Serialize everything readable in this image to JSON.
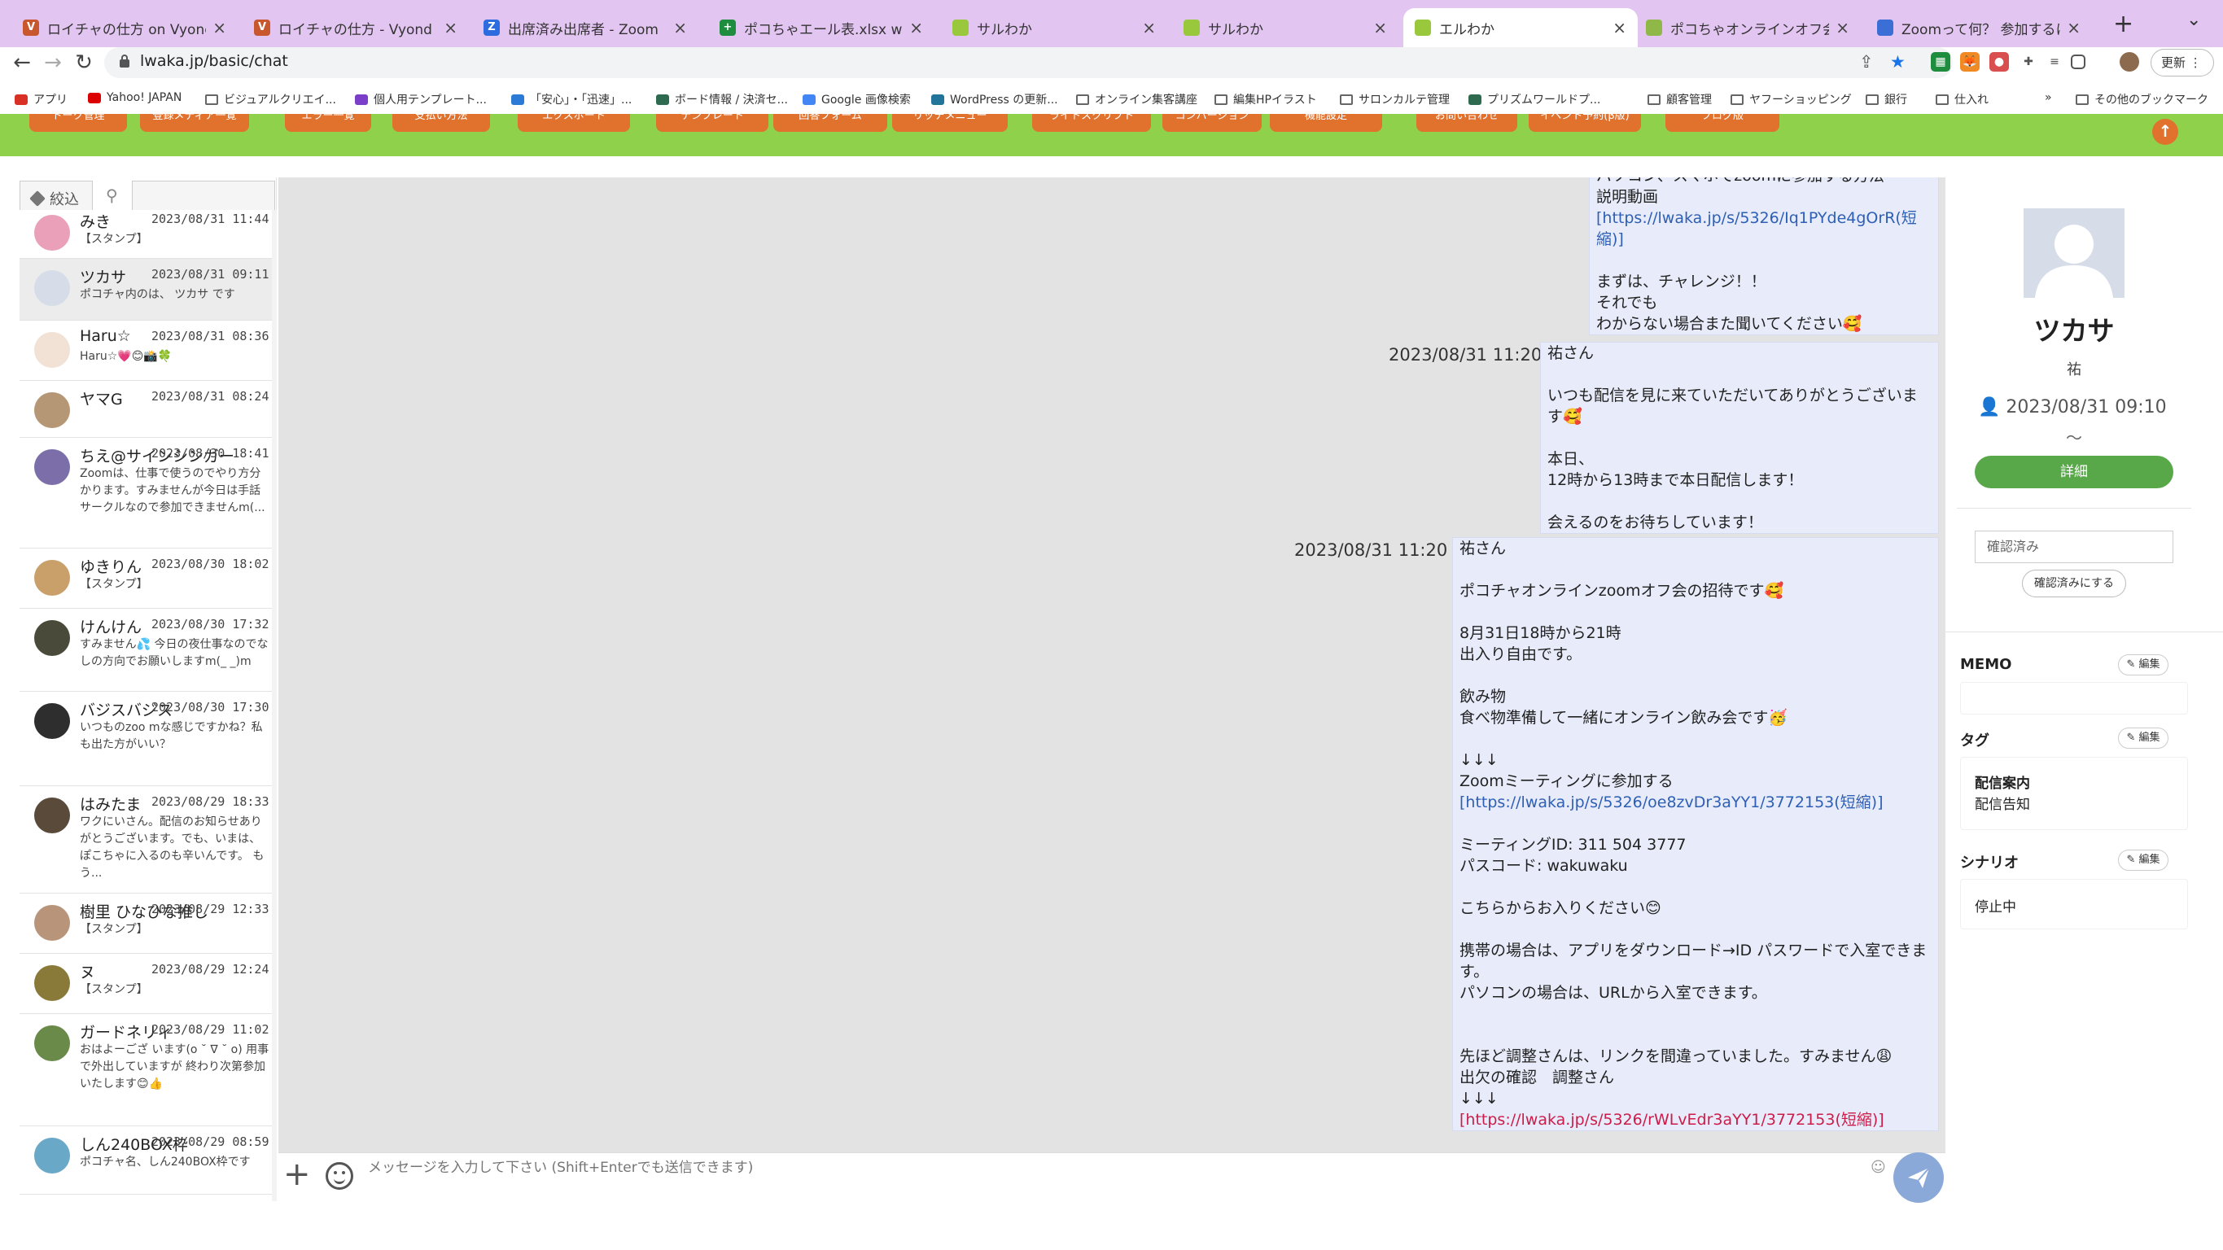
{
  "browser": {
    "tabs": [
      {
        "label": "ロイチャの仕方 on Vyond",
        "favicon": "V",
        "color": "#c9572e"
      },
      {
        "label": "ロイチャの仕方 - Vyond Studio",
        "favicon": "V",
        "color": "#c9572e"
      },
      {
        "label": "出席済み出席者 - Zoom",
        "favicon": "Z",
        "color": "#2d6cdf"
      },
      {
        "label": "ポコちゃエール表.xlsx wakuni",
        "favicon": "+",
        "color": "#1e8e3e"
      },
      {
        "label": "サルわか",
        "favicon": "",
        "color": "#9ac83c"
      },
      {
        "label": "サルわか",
        "favicon": "",
        "color": "#9ac83c"
      },
      {
        "label": "エルわか",
        "favicon": "",
        "color": "#9ac83c"
      },
      {
        "label": "ポコちゃオンラインオフ会 | 調整",
        "favicon": "",
        "color": "#8fb848"
      },
      {
        "label": "Zoomって何？ 参加するには、ど",
        "favicon": "",
        "color": "#3b6fd6"
      }
    ],
    "url": "lwaka.jp/basic/chat",
    "update_label": "更新",
    "bookmarks": [
      "アプリ",
      "Yahoo! JAPAN",
      "ビジュアルクリエイ...",
      "個人用テンプレート...",
      "「安心」・「迅速」...",
      "ボード情報 / 決済セ...",
      "Google 画像検索",
      "WordPress の更新...",
      "オンライン集客講座",
      "編集HPイラスト",
      "サロンカルテ管理",
      "プリズムワールドプ...",
      "顧客管理",
      "ヤフーショッピング",
      "銀行",
      "仕入れ"
    ],
    "bookmarks_more": "»",
    "other_bookmarks": "その他のブックマーク"
  },
  "nav_buttons": [
    "トーク管理",
    "登録メディア一覧",
    "エラー一覧",
    "支払い方法",
    "エクスポート",
    "テンプレート",
    "回答フォーム",
    "リッチメニュー",
    "ライトスクリプト",
    "コンバージョン",
    "機能設定",
    "お問い合わせ",
    "イベント予約(β版)",
    "ブログ版"
  ],
  "sidebar": {
    "filter_label": "絞込",
    "search_placeholder": "",
    "items": [
      {
        "name": "みき",
        "date": "2023/08/31 11:44",
        "msg": "【スタンプ】",
        "avatar_color": "#e9a0b8"
      },
      {
        "name": "ツカサ",
        "date": "2023/08/31 09:11",
        "msg": "ポコチャ内のは、 ツカサ です",
        "avatar_color": "#d6dde8"
      },
      {
        "name": "Haru☆",
        "date": "2023/08/31 08:36",
        "msg": "Haru☆💗😊📸🍀",
        "avatar_color": "#f2e2d6"
      },
      {
        "name": "ヤマG",
        "date": "2023/08/31 08:24",
        "msg": "",
        "avatar_color": "#b59776"
      },
      {
        "name": "ちえ@サインシンガー",
        "date": "2023/08/30 18:41",
        "msg": "Zoomは、仕事で使うのでやり方分かります。すみませんが今日は手話サークルなので参加できませんm(...",
        "avatar_color": "#7c6ea8"
      },
      {
        "name": "ゆきりん",
        "date": "2023/08/30 18:02",
        "msg": "【スタンプ】",
        "avatar_color": "#c9a06a"
      },
      {
        "name": "けんけん",
        "date": "2023/08/30 17:32",
        "msg": "すみません💦 今日の夜仕事なのでなしの方向でお願いしますm(_ _)m",
        "avatar_color": "#4a4a3a"
      },
      {
        "name": "バジスバジス",
        "date": "2023/08/30 17:30",
        "msg": "いつものzoo mな感じですかね？私も出た方がいい？",
        "avatar_color": "#2e2e2e"
      },
      {
        "name": "はみたま",
        "date": "2023/08/29 18:33",
        "msg": "ワクにいさん。配信のお知らせありがとうございます。でも、いまは、ぽこちゃに入るのも辛いんです。 もう...",
        "avatar_color": "#5a4a3a"
      },
      {
        "name": "樹里 ひなひな推し",
        "date": "2023/08/29 12:33",
        "msg": "【スタンプ】",
        "avatar_color": "#b8957a"
      },
      {
        "name": "ヌ",
        "date": "2023/08/29 12:24",
        "msg": "【スタンプ】",
        "avatar_color": "#8a7a3a"
      },
      {
        "name": "ガードネリィ",
        "date": "2023/08/29 11:02",
        "msg": "おはよーござ います(o ˘ ∇ ˘ o) 用事で外出していますが 終わり次第参加いたします😊👍",
        "avatar_color": "#6a8a4a"
      },
      {
        "name": "しん240BOX枠",
        "date": "2023/08/29 08:59",
        "msg": "ポコチャ名、しん240BOX枠です",
        "avatar_color": "#6aa8c8"
      }
    ]
  },
  "messages": [
    {
      "date": "",
      "lines": [
        "パソコン、スマホでzoomに参加する方法",
        "説明動画",
        "[https://lwaka.jp/s/5326/Iq1PYde4gOrR(短縮)]",
        "",
        "まずは、チャレンジ！！",
        "それでも",
        "わからない場合また聞いてください🥰"
      ]
    },
    {
      "date": "2023/08/31 11:20",
      "lines": [
        "祐さん",
        "",
        "いつも配信を見に来ていただいてありがとうございます🥰",
        "",
        "本日、",
        "12時から13時まで本日配信します！",
        "",
        "会えるのをお待ちしています！"
      ]
    },
    {
      "date": "2023/08/31 11:20",
      "lines": [
        "祐さん",
        "",
        "ポコチャオンラインzoomオフ会の招待です🥰",
        "",
        "8月31日18時から21時",
        "出入り自由です。",
        "",
        "飲み物",
        "食べ物準備して一緒にオンライン飲み会です🥳",
        "",
        "↓↓↓",
        "Zoomミーティングに参加する",
        "[https://lwaka.jp/s/5326/oe8zvDr3aYY1/3772153(短縮)]",
        "",
        "ミーティングID: 311 504 3777",
        "パスコード: wakuwaku",
        "",
        "こちらからお入りください😊",
        "",
        "携帯の場合は、アプリをダウンロード→ID パスワードで入室できます。",
        "パソコンの場合は、URLから入室できます。",
        "",
        "",
        "先ほど調整さんは、リンクを間違っていました。すみません😩",
        "出欠の確認　調整さん",
        "↓↓↓",
        "[https://lwaka.jp/s/5326/rWLvEdr3aYY1/3772153(短縮)]"
      ]
    }
  ],
  "input": {
    "placeholder": "メッセージを入力して下さい (Shift+Enterでも送信できます)"
  },
  "profile": {
    "name": "ツカサ",
    "sub": "祐",
    "date": "2023/08/31 09:10",
    "tilde": "〜",
    "detail_label": "詳細",
    "status_value": "確認済み",
    "confirm_label": "確認済みにする",
    "memo_title": "MEMO",
    "tag_title": "タグ",
    "tag_name": "配信案内",
    "tag_value": "配信告知",
    "scenario_title": "シナリオ",
    "scenario_value": "停止中",
    "edit_label": "編集"
  },
  "colors": {
    "green_bar": "#8fd14a",
    "nav_orange": "#e0722e",
    "detail_green": "#58a84a",
    "link_blue": "#2d5fb4",
    "link_red": "#cc1c4a",
    "tab_bar": "#e3c5f2"
  }
}
